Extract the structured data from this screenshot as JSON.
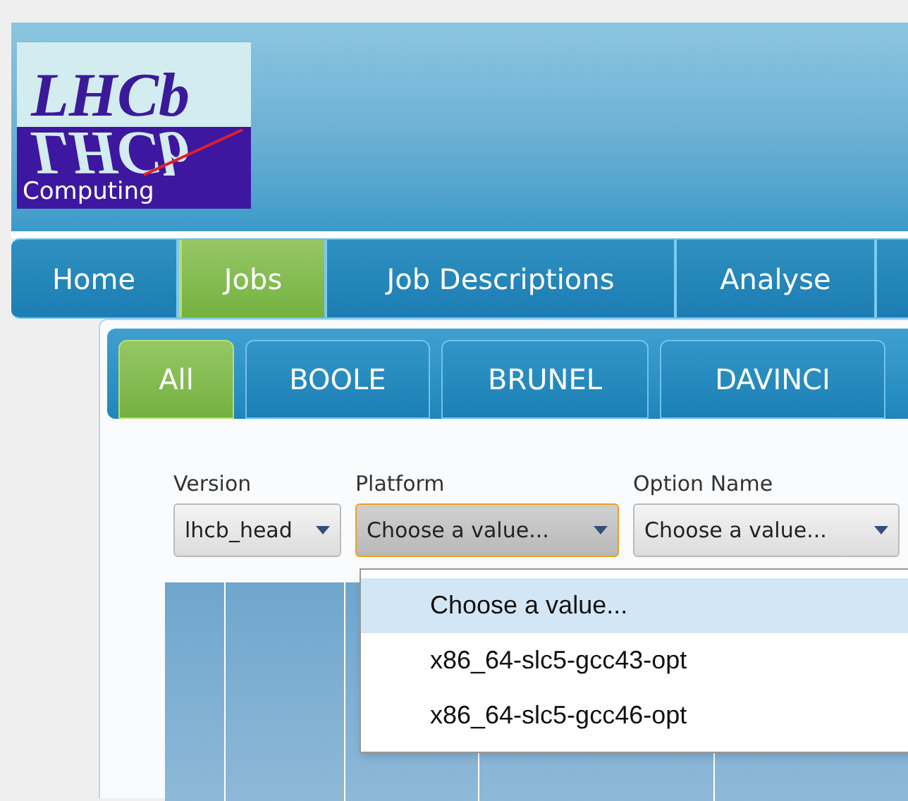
{
  "logo": {
    "title": "LHCb",
    "reflection": "LHCb",
    "subtitle": "Computing"
  },
  "nav": [
    {
      "label": "Home",
      "selected": false
    },
    {
      "label": "Jobs",
      "selected": true
    },
    {
      "label": "Job Descriptions",
      "selected": false
    },
    {
      "label": "Analyse",
      "selected": false
    }
  ],
  "subtabs": [
    {
      "label": "All",
      "selected": true
    },
    {
      "label": "BOOLE",
      "selected": false
    },
    {
      "label": "BRUNEL",
      "selected": false
    },
    {
      "label": "DAVINCI",
      "selected": false
    }
  ],
  "filters": [
    {
      "label": "Version",
      "value": "lhcb_head",
      "focused": false
    },
    {
      "label": "Platform",
      "value": "Choose a value...",
      "focused": true
    },
    {
      "label": "Option Name",
      "value": "Choose a value...",
      "focused": false
    }
  ],
  "dropdown": [
    {
      "label": "Choose a value...",
      "selected": true
    },
    {
      "label": "x86_64-slc5-gcc43-opt",
      "selected": false
    },
    {
      "label": "x86_64-slc5-gcc46-opt",
      "selected": false
    }
  ]
}
